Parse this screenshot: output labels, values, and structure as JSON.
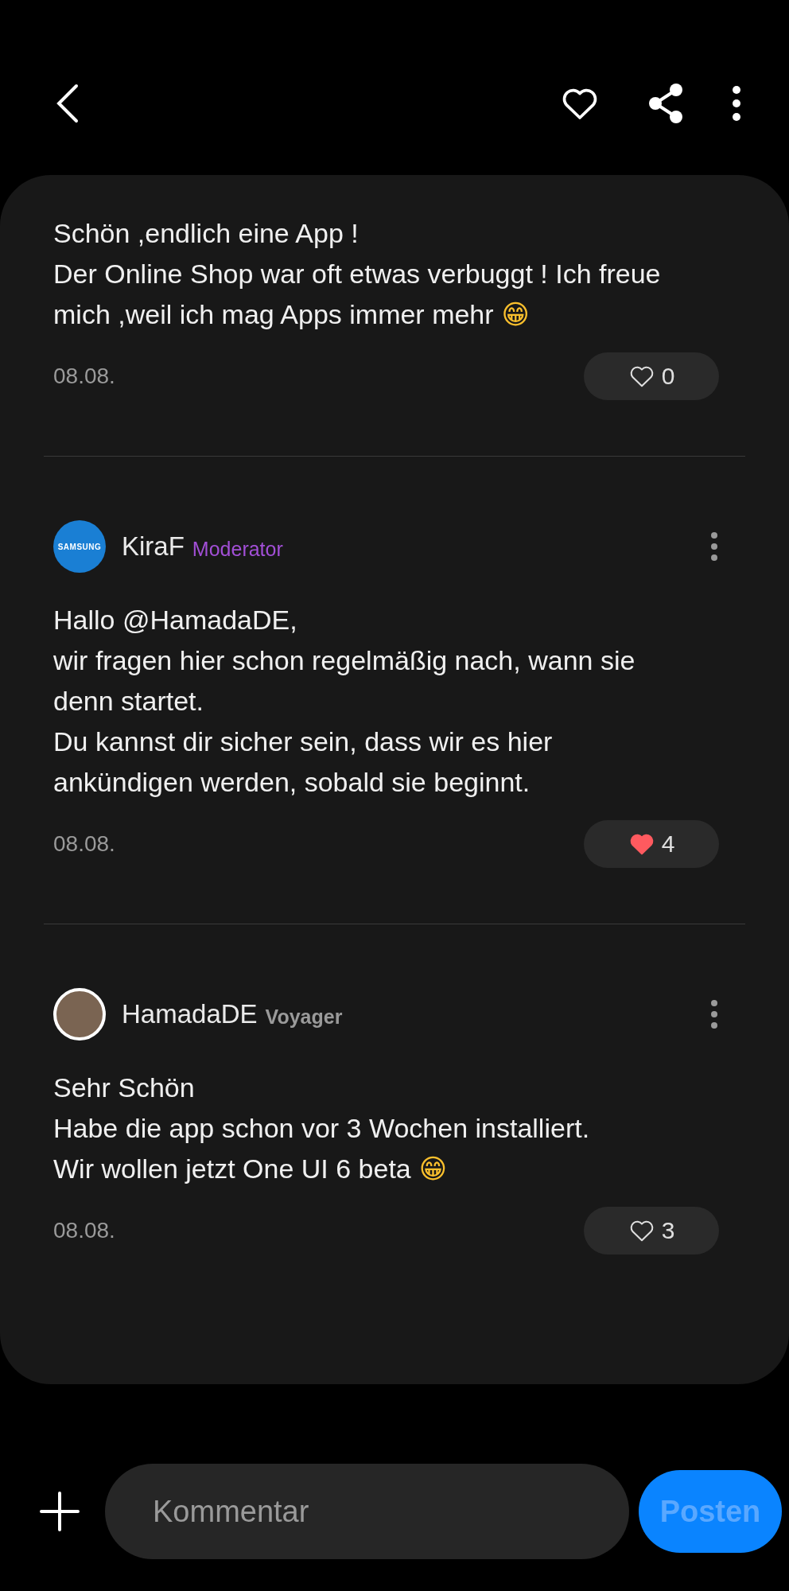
{
  "comments": [
    {
      "lines": [
        "Schön ,endlich eine App !",
        "Der Online Shop war oft etwas verbuggt ! Ich freue",
        "mich ,weil ich mag Apps immer mehr"
      ],
      "emoji": "😁",
      "date": "08.08.",
      "likes": "0",
      "liked": false
    },
    {
      "author": {
        "name": "KiraF",
        "role": "Moderator",
        "color": "#a24fd6",
        "avatar": {
          "kind": "logo",
          "text": "SAMSUNG"
        }
      },
      "lines": [
        "Hallo @HamadaDE,",
        "wir fragen hier schon regelmäßig nach, wann sie",
        "denn startet.",
        "Du kannst dir sicher sein, dass wir es hier",
        "ankündigen werden, sobald sie beginnt."
      ],
      "date": "08.08.",
      "likes": "4",
      "liked": true
    },
    {
      "author": {
        "name": "HamadaDE",
        "role": "Voyager",
        "color": "#9a9a9a",
        "avatar": {
          "kind": "photo"
        }
      },
      "lines": [
        "Sehr Schön",
        "Habe die app schon vor 3 Wochen installiert.",
        "Wir wollen jetzt One UI 6 beta"
      ],
      "emoji": "😁",
      "date": "08.08.",
      "likes": "3",
      "liked": false
    }
  ],
  "composer": {
    "placeholder": "Kommentar",
    "post_button": "Posten"
  }
}
